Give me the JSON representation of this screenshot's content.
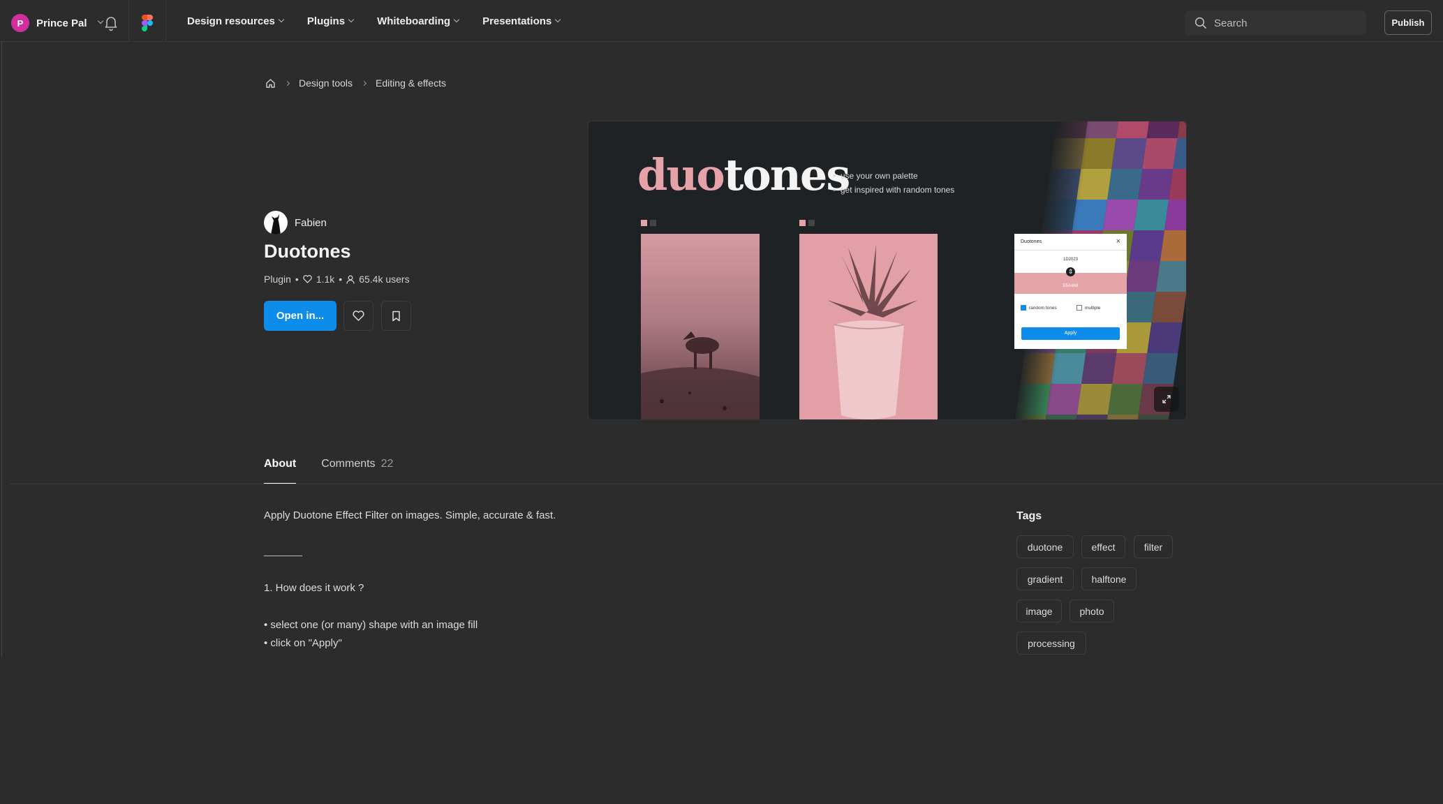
{
  "topbar": {
    "user": {
      "initial": "P",
      "name": "Prince Pal",
      "avatar_color": "#d0309f"
    },
    "nav": [
      {
        "label": "Design resources"
      },
      {
        "label": "Plugins"
      },
      {
        "label": "Whiteboarding"
      },
      {
        "label": "Presentations"
      }
    ],
    "search_placeholder": "Search",
    "publish_label": "Publish"
  },
  "breadcrumb": {
    "home_icon": "home-icon",
    "items": [
      "Design tools",
      "Editing & effects"
    ]
  },
  "plugin": {
    "author": "Fabien",
    "title": "Duotones",
    "type": "Plugin",
    "likes": "1.1k",
    "users": "65.4k users",
    "open_label": "Open in...",
    "accent": "#0d8ce9"
  },
  "preview": {
    "title_part1": "duo",
    "title_part2": "tones",
    "bullets": [
      "use your own palette",
      "get inspired with random tones"
    ],
    "mini_ui": {
      "title": "Duotones",
      "color_top": "1D2023",
      "color_bottom": "E5A4A8",
      "option1": "random tones",
      "option2": "multiple",
      "apply": "Apply"
    },
    "pink": "#e6a2a9"
  },
  "tabs": {
    "about": "About",
    "comments": "Comments",
    "comments_count": "22"
  },
  "about": {
    "intro": "Apply Duotone Effect Filter on images. Simple, accurate & fast.",
    "heading": "1. How does it work ?",
    "steps": [
      "• select one (or many) shape with an image fill",
      "• click on \"Apply\""
    ]
  },
  "tags": {
    "heading": "Tags",
    "items": [
      "duotone",
      "effect",
      "filter",
      "gradient",
      "halftone",
      "image",
      "photo",
      "processing"
    ]
  }
}
